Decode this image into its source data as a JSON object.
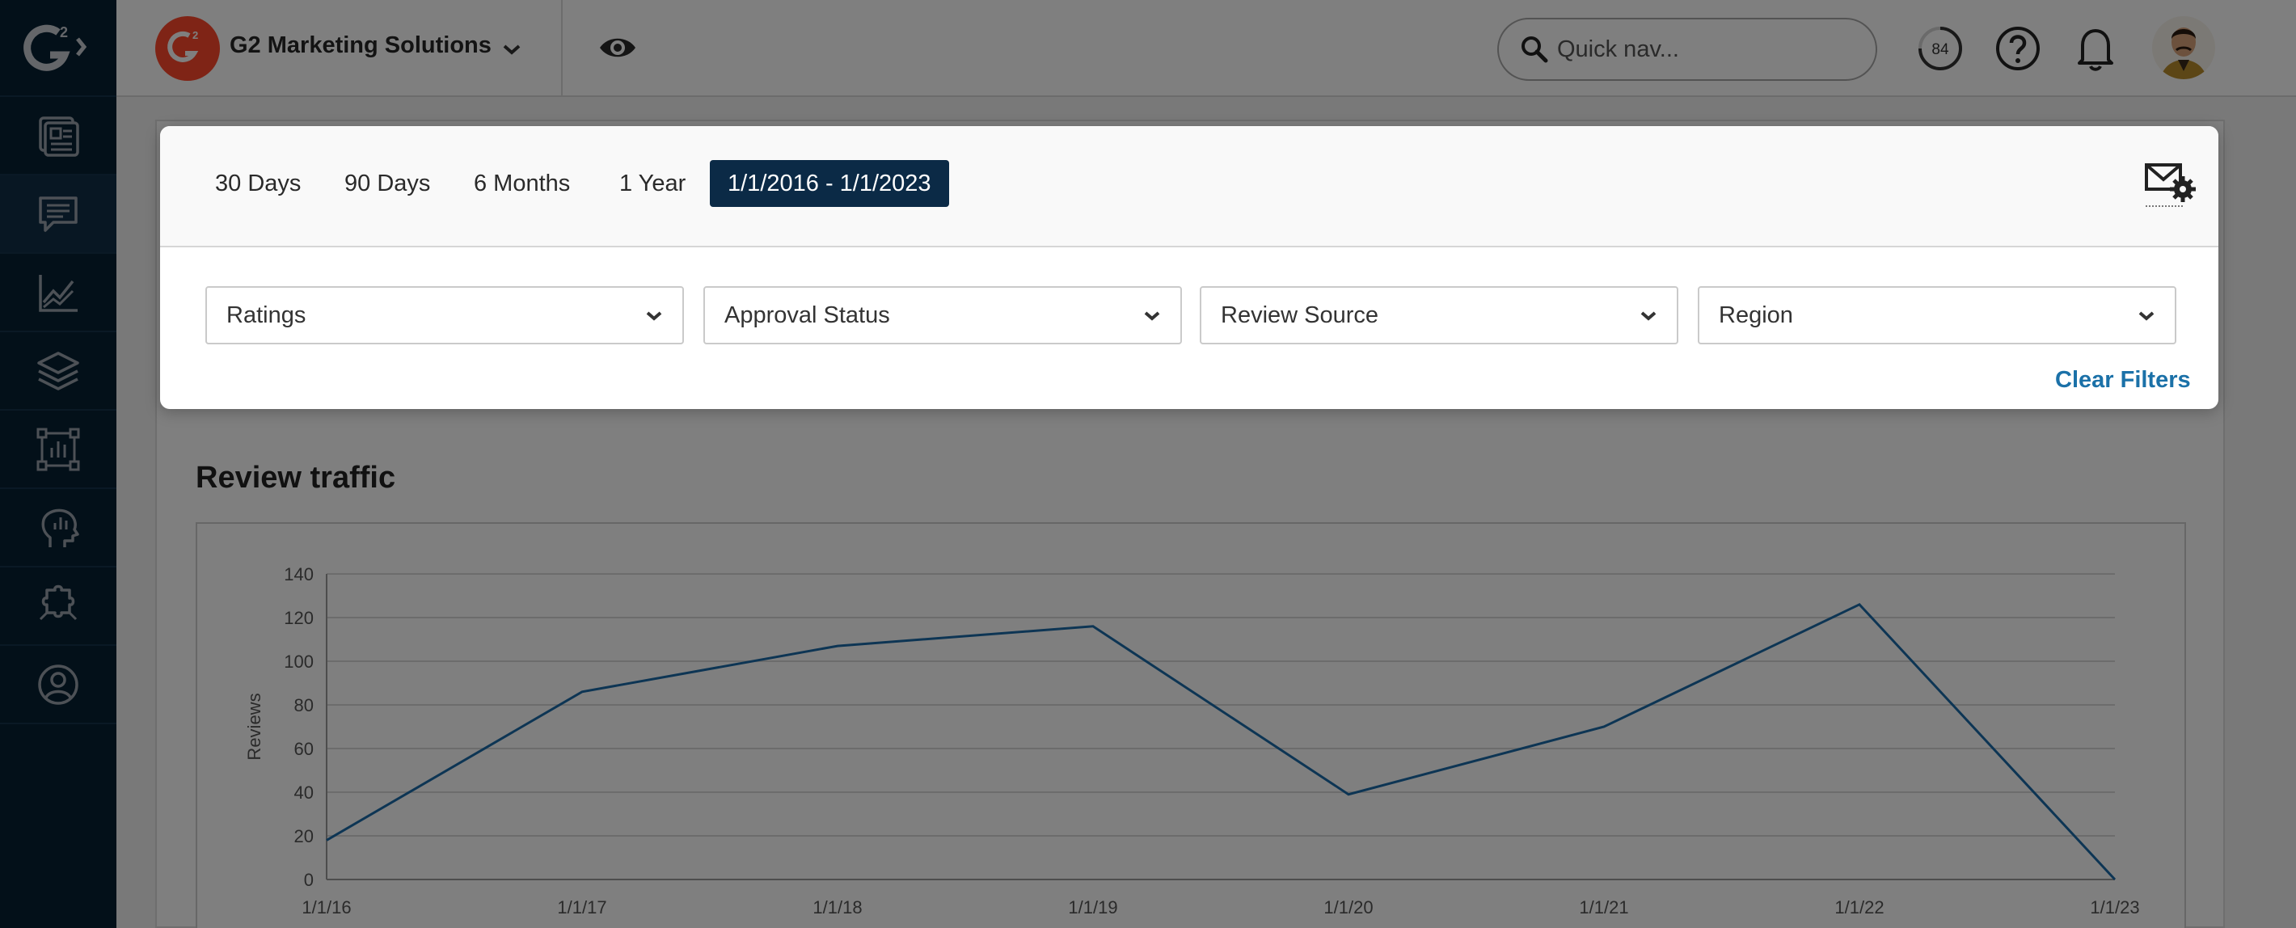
{
  "sidebar": {
    "logo_superscript": "2",
    "items": [
      {
        "icon": "dashboard-icon",
        "active": false
      },
      {
        "icon": "reviews-chat-icon",
        "active": true
      },
      {
        "icon": "analytics-chart-icon",
        "active": false
      },
      {
        "icon": "layers-icon",
        "active": false
      },
      {
        "icon": "report-frame-icon",
        "active": false
      },
      {
        "icon": "buyer-intent-head-icon",
        "active": false
      },
      {
        "icon": "integrations-puzzle-icon",
        "active": false
      },
      {
        "icon": "profile-icon",
        "active": false
      }
    ]
  },
  "header": {
    "org_logo_text": "G",
    "org_logo_superscript": "2",
    "org_name": "G2 Marketing Solutions",
    "search_placeholder": "Quick nav...",
    "badge_count": "84"
  },
  "date_ranges": [
    {
      "label": "30 Days",
      "active": false
    },
    {
      "label": "90 Days",
      "active": false
    },
    {
      "label": "6 Months",
      "active": false
    },
    {
      "label": "1 Year",
      "active": false
    },
    {
      "label": "1/1/2016 - 1/1/2023",
      "active": true
    }
  ],
  "filters": {
    "ratings": "Ratings",
    "approval_status": "Approval Status",
    "review_source": "Review Source",
    "region": "Region",
    "clear_label": "Clear Filters"
  },
  "section": {
    "title": "Review traffic"
  },
  "colors": {
    "sidebar_bg": "#062033",
    "accent": "#0b2a46",
    "link": "#1b71a8",
    "brand_red": "#ff492c",
    "line": "#1a6aa8"
  },
  "chart_data": {
    "type": "line",
    "title": "",
    "xlabel": "",
    "ylabel": "Reviews",
    "ylim": [
      0,
      140
    ],
    "yticks": [
      0,
      20,
      40,
      60,
      80,
      100,
      120,
      140
    ],
    "grid": true,
    "categories": [
      "1/1/16",
      "1/1/17",
      "1/1/18",
      "1/1/19",
      "1/1/20",
      "1/1/21",
      "1/1/22",
      "1/1/23"
    ],
    "values": [
      18,
      86,
      107,
      116,
      39,
      70,
      126,
      0
    ]
  }
}
